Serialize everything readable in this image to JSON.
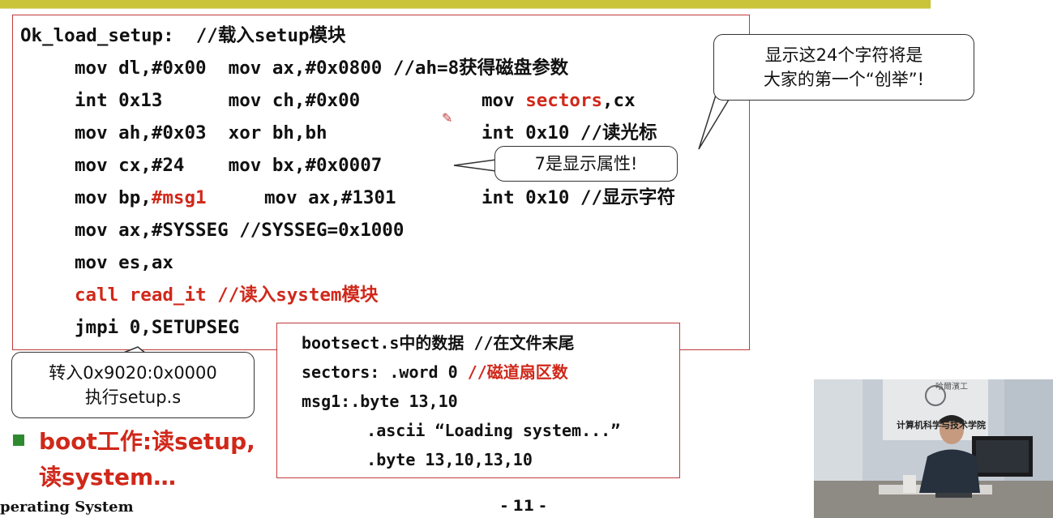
{
  "code": {
    "lines": [
      "Ok_load_setup:  //载入setup模块",
      "mov dl,#0x00  mov ax,#0x0800 //ah=8获得磁盘参数",
      "int 0x13      mov ch,#0x00",
      "mov sectors,cx",
      "mov ah,#0x03  xor bh,bh",
      "int 0x10 //读光标",
      "mov cx,#24    mov bx,#0x0007",
      "mov bp,",
      "#msg1",
      "mov ax,#1301",
      "int 0x10 //显示字符",
      "mov ax,#SYSSEG //SYSSEG=0x1000",
      "mov es,ax",
      "call read_it //读入system模块",
      "jmpi 0,SETUPSEG"
    ],
    "mov_sectors_prefix": "mov ",
    "sectors_word": "sectors",
    "cx_suffix": ",cx"
  },
  "callouts": {
    "top_right": [
      "显示这24个字符将是",
      "大家的第一个“创举”!"
    ],
    "attr": "7是显示属性!",
    "jump": [
      "转入0x9020:0x0000",
      "执行setup.s"
    ]
  },
  "data_box": {
    "line1": "bootsect.s中的数据 //在文件末尾",
    "line2a": "sectors: .word 0 ",
    "line2b": "//磁道扇区数",
    "line3": "msg1:.byte 13,10",
    "line4": "    .ascii “Loading system...”",
    "line5": "    .byte 13,10,13,10"
  },
  "bullet": {
    "line1": "boot工作:读setup,",
    "line2": "读system…"
  },
  "footer": {
    "left": "perating System",
    "page": "- 11 -"
  },
  "video": {
    "sign_top": "哈爾濱工",
    "sign_text": "计算机科学与技术学院"
  },
  "colors": {
    "accent_red": "#d0281a",
    "top_bar": "#c9c43a",
    "navy": "#27358a",
    "bullet_green": "#2f8a2f"
  }
}
